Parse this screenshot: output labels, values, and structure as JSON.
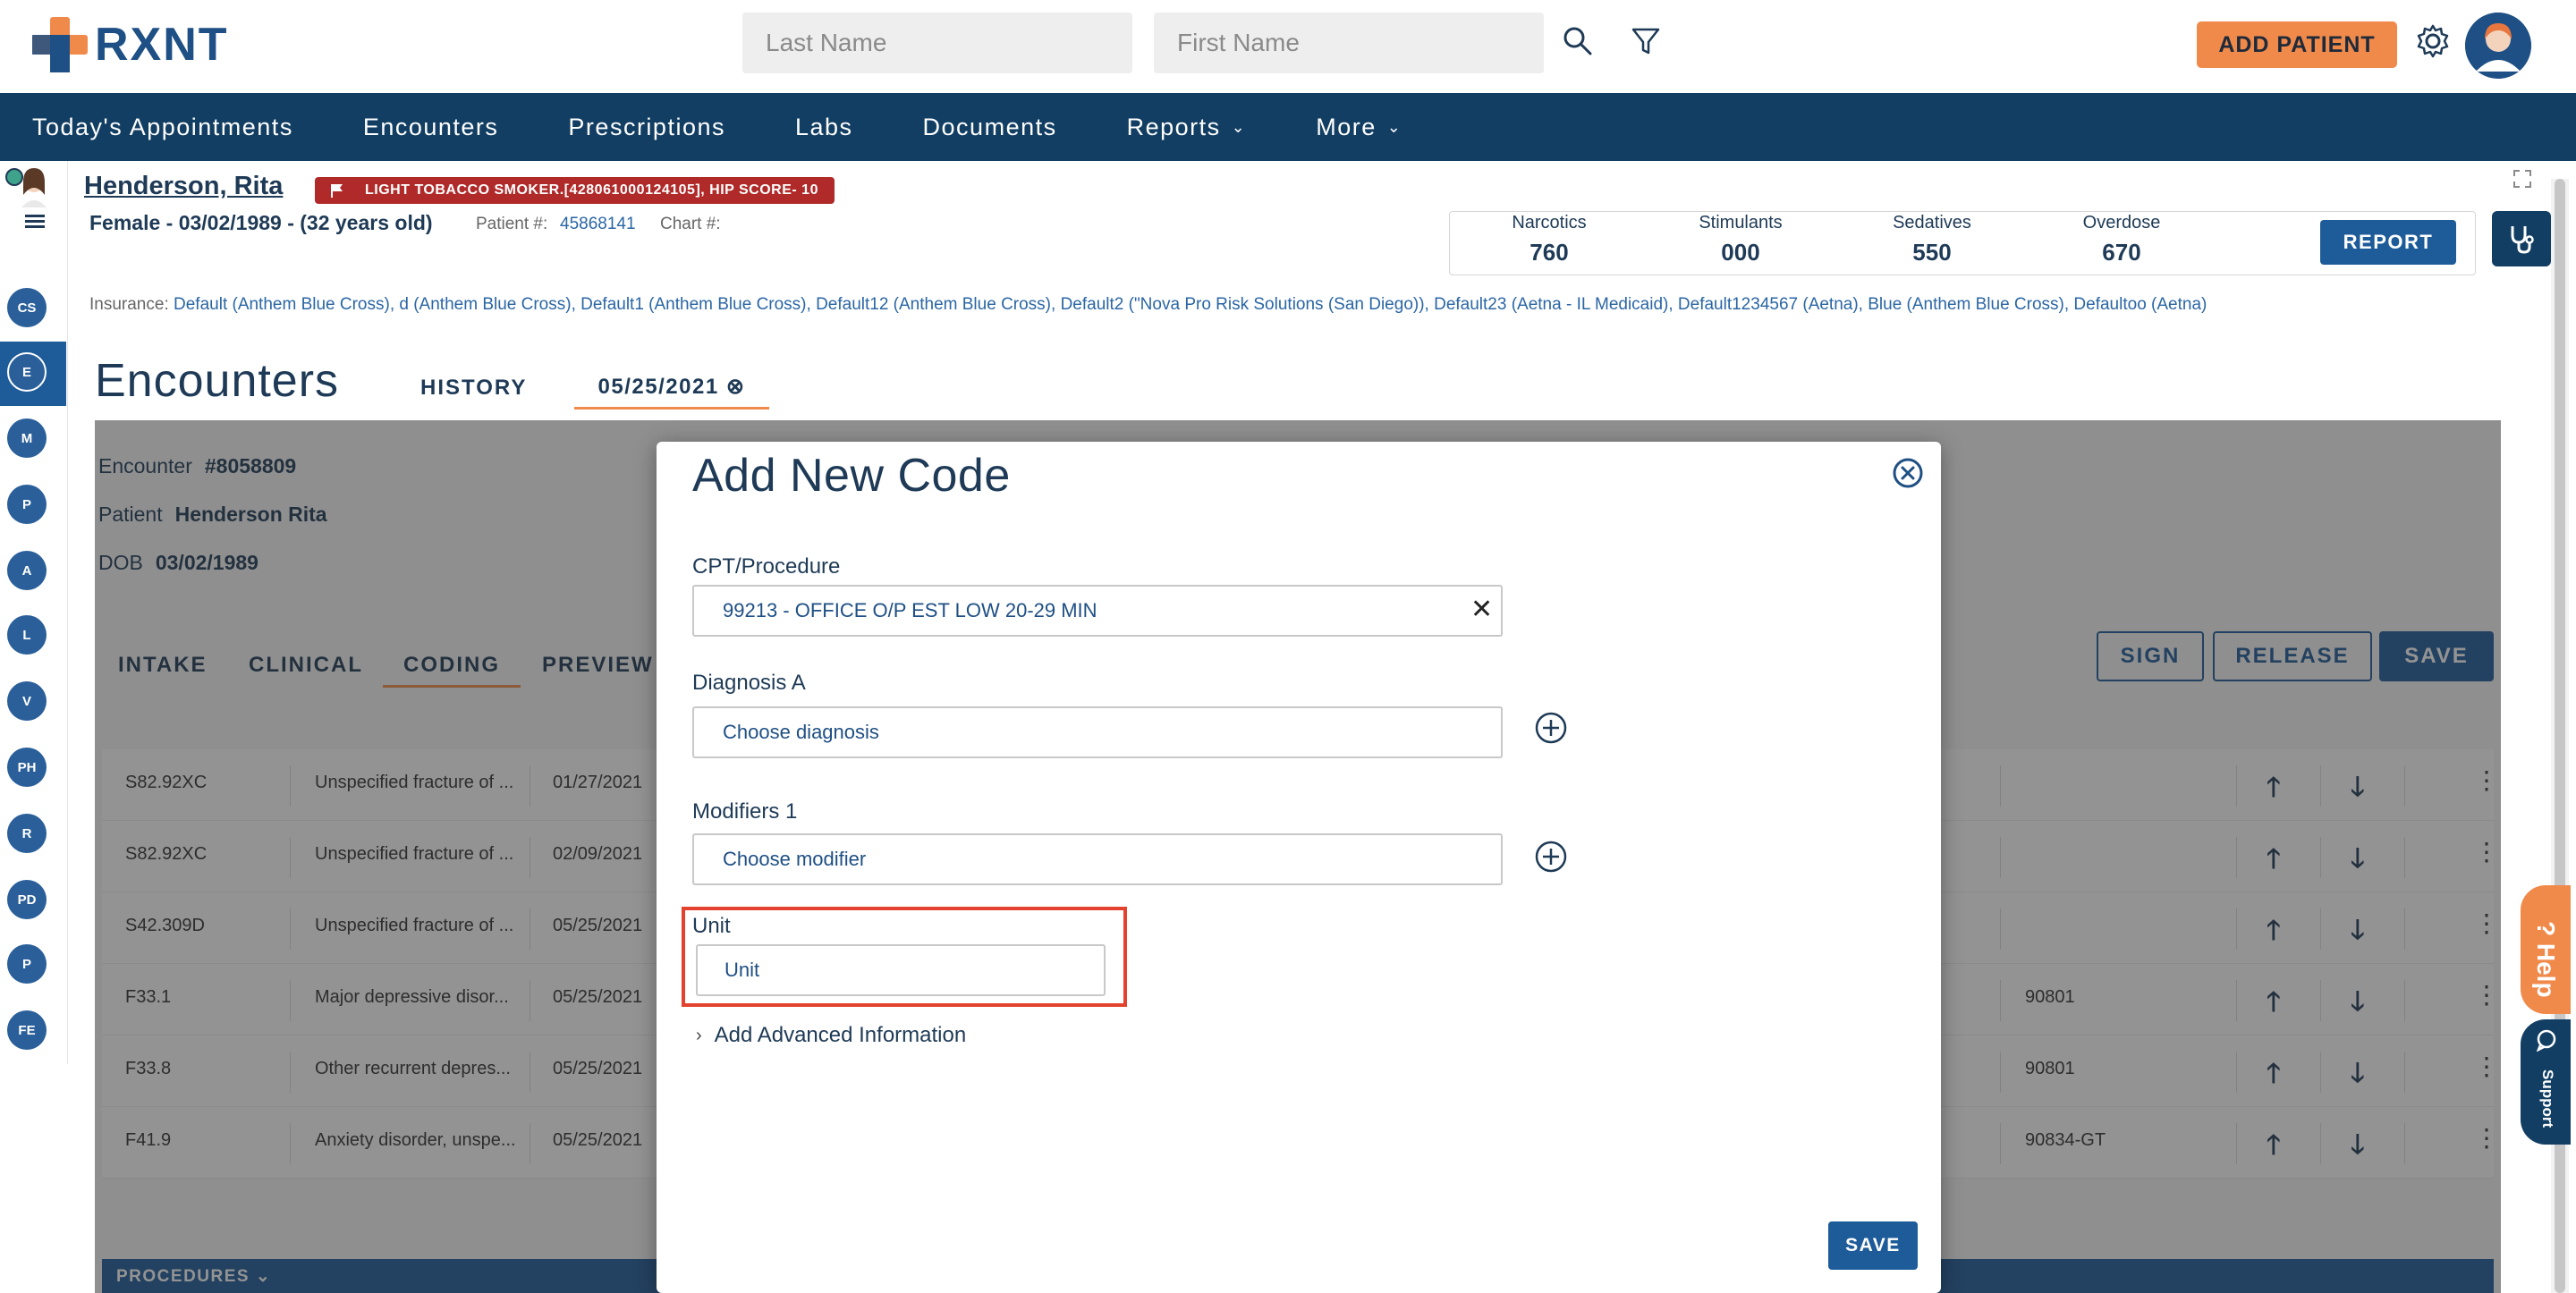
{
  "app": {
    "logo_text": "RXNT",
    "colors": {
      "primary": "#123e63",
      "accent": "#f08a4b",
      "alert": "#b02a2a",
      "link": "#2a66a5",
      "highlight": "#e3422e"
    }
  },
  "header": {
    "last_name_placeholder": "Last Name",
    "first_name_placeholder": "First Name",
    "search_icon": "search-icon",
    "filter_icon": "filter-icon",
    "add_patient_label": "ADD PATIENT",
    "settings_icon": "gear-icon"
  },
  "nav": {
    "items": [
      {
        "label": "Today's Appointments",
        "has_dropdown": false
      },
      {
        "label": "Encounters",
        "has_dropdown": false
      },
      {
        "label": "Prescriptions",
        "has_dropdown": false
      },
      {
        "label": "Labs",
        "has_dropdown": false
      },
      {
        "label": "Documents",
        "has_dropdown": false
      },
      {
        "label": "Reports",
        "has_dropdown": true
      },
      {
        "label": "More",
        "has_dropdown": true
      }
    ],
    "chevron": "⌄"
  },
  "patient": {
    "name": "Henderson, Rita",
    "flag_text": "LIGHT TOBACCO SMOKER.[428061000124105], HIP SCORE- 10",
    "demographics": "Female - 03/02/1989 - (32 years old)",
    "patient_num_label": "Patient #:",
    "patient_num": "45868141",
    "chart_label": "Chart #:",
    "insurance_label": "Insurance:",
    "insurance_value": "Default (Anthem Blue Cross), d (Anthem Blue Cross), Default1 (Anthem Blue Cross), Default12 (Anthem Blue Cross), Default2 (\"Nova Pro Risk Solutions (San Diego)), Default23 (Aetna - IL Medicaid), Default1234567 (Aetna), Blue (Anthem Blue Cross), Defaultoo (Aetna)"
  },
  "pdmp": {
    "items": [
      {
        "label": "Narcotics",
        "value": "760"
      },
      {
        "label": "Stimulants",
        "value": "000"
      },
      {
        "label": "Sedatives",
        "value": "550"
      },
      {
        "label": "Overdose",
        "value": "670"
      }
    ],
    "report_label": "REPORT"
  },
  "rail": {
    "items": [
      "CS",
      "E",
      "M",
      "P",
      "A",
      "L",
      "V",
      "PH",
      "R",
      "PD",
      "P",
      "FE"
    ],
    "active": "E"
  },
  "encounters": {
    "title": "Encounters",
    "tab_history": "HISTORY",
    "tab_date": "05/25/2021 ⊗",
    "encounter_label": "Encounter",
    "encounter_value": "#8058809",
    "patient_label": "Patient",
    "patient_value": "Henderson Rita",
    "dob_label": "DOB",
    "dob_value": "03/02/1989",
    "tabs": [
      "INTAKE",
      "CLINICAL",
      "CODING",
      "PREVIEW"
    ],
    "active_tab": "CODING",
    "sign_label": "SIGN",
    "release_label": "RELEASE",
    "save_label": "SAVE",
    "rows": [
      {
        "code": "S82.92XC",
        "desc": "Unspecified fracture of ...",
        "date": "01/27/2021",
        "extra": ""
      },
      {
        "code": "S82.92XC",
        "desc": "Unspecified fracture of ...",
        "date": "02/09/2021",
        "extra": ""
      },
      {
        "code": "S42.309D",
        "desc": "Unspecified fracture of ...",
        "date": "05/25/2021",
        "extra": ""
      },
      {
        "code": "F33.1",
        "desc": "Major depressive disor...",
        "date": "05/25/2021",
        "extra": "90801"
      },
      {
        "code": "F33.8",
        "desc": "Other recurrent depres...",
        "date": "05/25/2021",
        "extra": "90801"
      },
      {
        "code": "F41.9",
        "desc": "Anxiety disorder, unspe...",
        "date": "05/25/2021",
        "extra": "90834-GT"
      }
    ],
    "up_arrow": "🡑",
    "down_arrow": "🡓",
    "menu_dots": "⋮",
    "procedures_label": "PROCEDURES ⌄"
  },
  "modal": {
    "title": "Add New Code",
    "cpt_label": "CPT/Procedure",
    "cpt_value": "99213 - OFFICE O/P EST LOW 20-29 MIN",
    "clear_symbol": "✕",
    "diagnosis_label": "Diagnosis A",
    "diagnosis_placeholder": "Choose diagnosis",
    "modifier_label": "Modifiers 1",
    "modifier_placeholder": "Choose modifier",
    "unit_label": "Unit",
    "unit_placeholder": "Unit",
    "advanced_label": "Add Advanced Information",
    "advanced_chevron": "›",
    "save_label": "SAVE"
  },
  "side_widgets": {
    "help_label": "? Help",
    "support_label": "Support"
  }
}
